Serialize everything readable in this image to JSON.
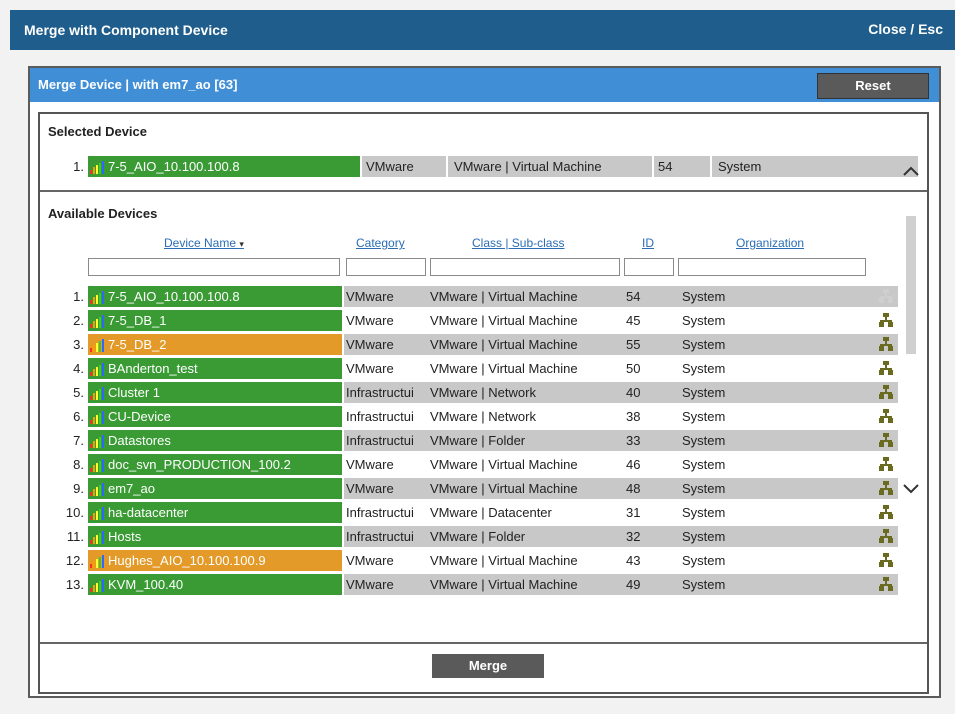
{
  "window": {
    "title": "Merge with Component Device",
    "close_label": "Close / Esc"
  },
  "panel": {
    "title": "Merge Device | with em7_ao [63]",
    "reset_label": "Reset"
  },
  "selected": {
    "title": "Selected Device",
    "device": {
      "num": "1.",
      "name": "7-5_AIO_10.100.100.8",
      "category": "VMware",
      "class": "VMware | Virtual Machine",
      "id": "54",
      "org": "System",
      "color": "#3a9b35"
    }
  },
  "available": {
    "title": "Available Devices",
    "headers": {
      "name": "Device Name",
      "sort_indicator": "▾",
      "category": "Category",
      "class": "Class | Sub-class",
      "id": "ID",
      "org": "Organization"
    },
    "rows": [
      {
        "num": "1.",
        "name": "7-5_AIO_10.100.100.8",
        "category": "VMware",
        "class": "VMware | Virtual Machine",
        "id": "54",
        "org": "System",
        "status": "green",
        "icon": "disabled-merge-icon"
      },
      {
        "num": "2.",
        "name": "7-5_DB_1",
        "category": "VMware",
        "class": "VMware | Virtual Machine",
        "id": "45",
        "org": "System",
        "status": "green",
        "icon": "merge-icon"
      },
      {
        "num": "3.",
        "name": "7-5_DB_2",
        "category": "VMware",
        "class": "VMware | Virtual Machine",
        "id": "55",
        "org": "System",
        "status": "orange",
        "icon": "merge-icon"
      },
      {
        "num": "4.",
        "name": "BAnderton_test",
        "category": "VMware",
        "class": "VMware | Virtual Machine",
        "id": "50",
        "org": "System",
        "status": "green",
        "icon": "merge-icon"
      },
      {
        "num": "5.",
        "name": "Cluster 1",
        "category": "Infrastructui",
        "class": "VMware | Network",
        "id": "40",
        "org": "System",
        "status": "green",
        "icon": "merge-icon"
      },
      {
        "num": "6.",
        "name": "CU-Device",
        "category": "Infrastructui",
        "class": "VMware | Network",
        "id": "38",
        "org": "System",
        "status": "green",
        "icon": "merge-icon"
      },
      {
        "num": "7.",
        "name": "Datastores",
        "category": "Infrastructui",
        "class": "VMware | Folder",
        "id": "33",
        "org": "System",
        "status": "green",
        "icon": "merge-icon"
      },
      {
        "num": "8.",
        "name": "doc_svn_PRODUCTION_100.2",
        "category": "VMware",
        "class": "VMware | Virtual Machine",
        "id": "46",
        "org": "System",
        "status": "green",
        "icon": "merge-icon"
      },
      {
        "num": "9.",
        "name": "em7_ao",
        "category": "VMware",
        "class": "VMware | Virtual Machine",
        "id": "48",
        "org": "System",
        "status": "green",
        "icon": "merge-icon"
      },
      {
        "num": "10.",
        "name": "ha-datacenter",
        "category": "Infrastructui",
        "class": "VMware | Datacenter",
        "id": "31",
        "org": "System",
        "status": "green",
        "icon": "merge-icon"
      },
      {
        "num": "11.",
        "name": "Hosts",
        "category": "Infrastructui",
        "class": "VMware | Folder",
        "id": "32",
        "org": "System",
        "status": "green",
        "icon": "merge-icon"
      },
      {
        "num": "12.",
        "name": "Hughes_AIO_10.100.100.9",
        "category": "VMware",
        "class": "VMware | Virtual Machine",
        "id": "43",
        "org": "System",
        "status": "orange",
        "icon": "merge-icon"
      },
      {
        "num": "13.",
        "name": "KVM_100.40",
        "category": "VMware",
        "class": "VMware | Virtual Machine",
        "id": "49",
        "org": "System",
        "status": "green",
        "icon": "merge-icon"
      }
    ]
  },
  "footer": {
    "merge_label": "Merge"
  },
  "colors": {
    "title_bar": "#1f5d8c",
    "subheader": "#3f8ed6",
    "healthy": "#3a9b35",
    "warning": "#e39a28",
    "row_alt": "#c8c8c8"
  }
}
